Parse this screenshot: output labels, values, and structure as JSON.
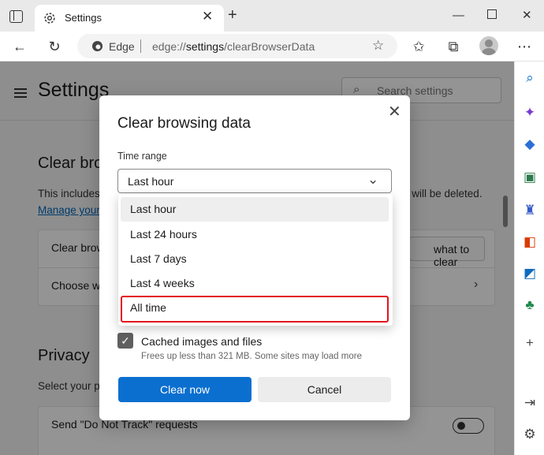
{
  "browser": {
    "tab_title": "Settings",
    "address_site": "Edge",
    "address_url_prefix": "edge://",
    "address_url_bold": "settings",
    "address_url_suffix": "/clearBrowserData"
  },
  "settings_page": {
    "title": "Settings",
    "search_placeholder": "Search settings",
    "section_heading": "Clear bro",
    "section_text_left": "This includes",
    "section_text_right": "e will be deleted.",
    "manage_link": "Manage your",
    "row_clear": "Clear brow",
    "choose_button": "what to clear",
    "row_choose": "Choose wh",
    "privacy_heading": "Privacy",
    "privacy_text": "Select your p",
    "dnt_label": "Send \"Do Not Track\" requests"
  },
  "dialog": {
    "title": "Clear browsing data",
    "time_range_label": "Time range",
    "time_range_value": "Last hour",
    "options": [
      "Last hour",
      "Last 24 hours",
      "Last 7 days",
      "Last 4 weeks",
      "All time"
    ],
    "cached_label": "Cached images and files",
    "cached_desc": "Frees up less than 321 MB. Some sites may load more",
    "clear_button": "Clear now",
    "cancel_button": "Cancel"
  },
  "colors": {
    "primary": "#0b6fcf",
    "highlight": "#e2151d"
  }
}
